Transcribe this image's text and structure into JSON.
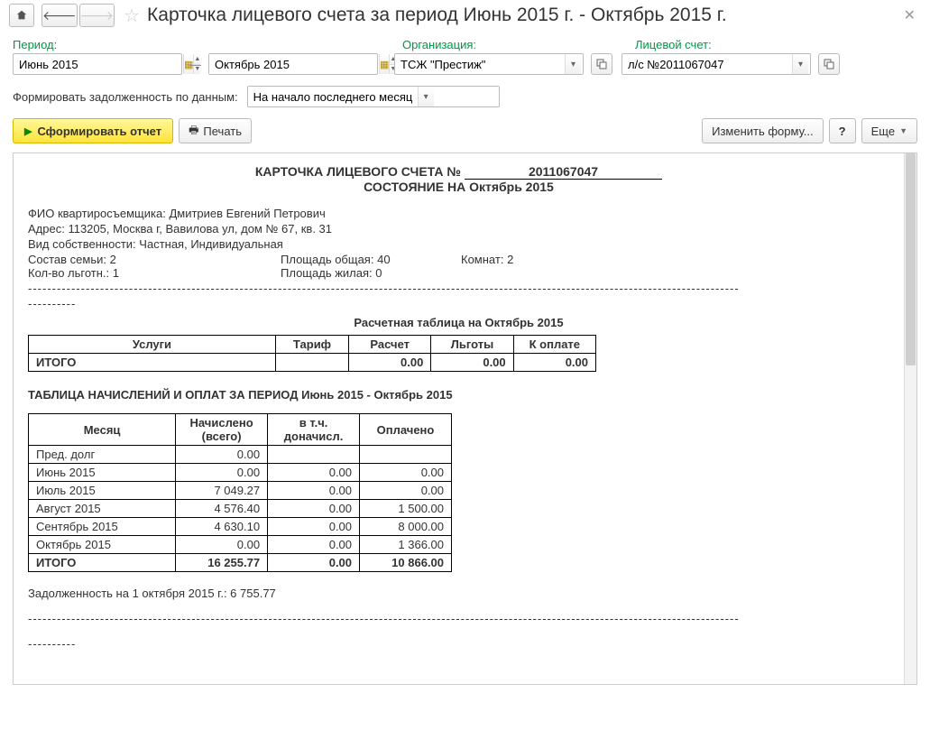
{
  "window": {
    "title": "Карточка лицевого счета за период Июнь 2015 г. - Октябрь 2015 г."
  },
  "params": {
    "period_label": "Период:",
    "period_from": "Июнь 2015",
    "period_to": "Октябрь 2015",
    "org_label": "Организация:",
    "org_value": "ТСЖ \"Престиж\"",
    "account_label": "Лицевой счет:",
    "account_value": "л/с №2011067047",
    "debt_label": "Формировать задолженность по данным:",
    "debt_value": "На начало последнего месяца периода"
  },
  "toolbar": {
    "form_report": "Сформировать отчет",
    "print": "Печать",
    "change_form": "Изменить форму...",
    "more": "Еще"
  },
  "report": {
    "header_prefix": "КАРТОЧКА ЛИЦЕВОГО СЧЕТА №",
    "account_number": "2011067047",
    "status_line": "СОСТОЯНИЕ НА Октябрь 2015",
    "fio_label": "ФИО квартиросъемщика:",
    "fio": "Дмитриев Евгений Петрович",
    "addr_label": "Адрес:",
    "addr": "113205, Москва г, Вавилова ул, дом № 67, кв. 31",
    "own_label": "Вид собственности:",
    "own": "Частная, Индивидуальная",
    "family_label": "Состав семьи:",
    "family": "2",
    "area_total_label": "Площадь общая:",
    "area_total": "40",
    "rooms_label": "Комнат:",
    "rooms": "2",
    "benefit_label": "Кол-во льготн.:",
    "benefit": "1",
    "area_live_label": "Площадь жилая:",
    "area_live": "0",
    "calc_title": "Расчетная таблица на Октябрь 2015",
    "calc_headers": {
      "services": "Услуги",
      "tariff": "Тариф",
      "calc": "Расчет",
      "benefits": "Льготы",
      "topay": "К оплате"
    },
    "calc_total_label": "ИТОГО",
    "calc_totals": {
      "calc": "0.00",
      "benefits": "0.00",
      "topay": "0.00"
    },
    "accr_title": "ТАБЛИЦА НАЧИСЛЕНИЙ И ОПЛАТ ЗА ПЕРИОД Июнь 2015 - Октябрь 2015",
    "accr_headers": {
      "month": "Месяц",
      "accrued": "Начислено (всего)",
      "incl": "в т.ч. доначисл.",
      "paid": "Оплачено"
    },
    "accr_rows": [
      {
        "month": "Пред. долг",
        "accrued": "0.00",
        "incl": "",
        "paid": ""
      },
      {
        "month": "Июнь 2015",
        "accrued": "0.00",
        "incl": "0.00",
        "paid": "0.00"
      },
      {
        "month": "Июль 2015",
        "accrued": "7 049.27",
        "incl": "0.00",
        "paid": "0.00"
      },
      {
        "month": "Август 2015",
        "accrued": "4 576.40",
        "incl": "0.00",
        "paid": "1 500.00"
      },
      {
        "month": "Сентябрь 2015",
        "accrued": "4 630.10",
        "incl": "0.00",
        "paid": "8 000.00"
      },
      {
        "month": "Октябрь 2015",
        "accrued": "0.00",
        "incl": "0.00",
        "paid": "1 366.00"
      }
    ],
    "accr_total": {
      "month": "ИТОГО",
      "accrued": "16 255.77",
      "incl": "0.00",
      "paid": "10 866.00"
    },
    "debt_line": "Задолженность на 1 октября 2015 г.: 6 755.77"
  }
}
